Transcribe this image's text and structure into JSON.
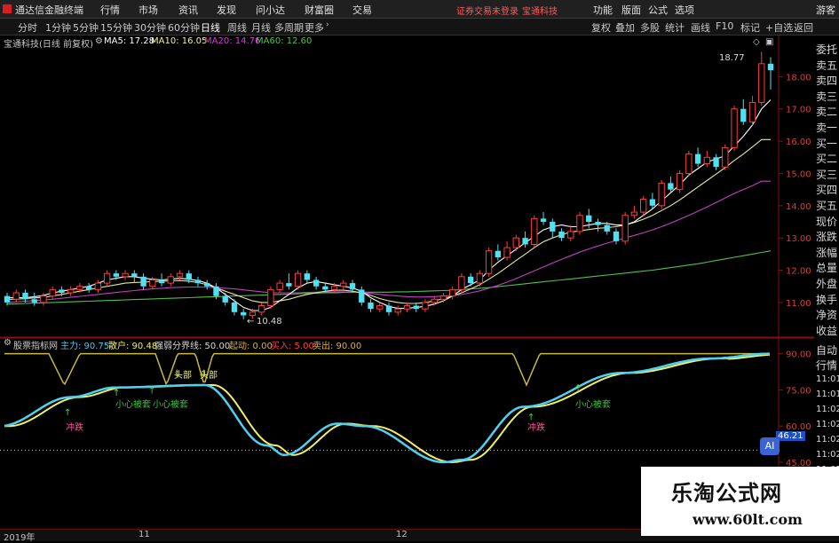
{
  "menubar": {
    "app_title": "通达信金融终端",
    "menus": [
      "行情",
      "市场",
      "资讯",
      "发现",
      "问小达",
      "财富圈",
      "交易"
    ],
    "notice": "证券交易未登录",
    "security": "宝通科技",
    "right_menus": [
      "功能",
      "版面",
      "公式",
      "选项"
    ],
    "guest": "游客"
  },
  "toolbar": {
    "tabs": [
      "分时",
      "1分钟",
      "5分钟",
      "15分钟",
      "30分钟",
      "60分钟",
      "日线",
      "周线",
      "月线",
      "多周期",
      "更多"
    ],
    "active_tab": "日线",
    "right_buttons": [
      "复权",
      "叠加",
      "多股",
      "统计",
      "画线",
      "F10",
      "标记",
      "+自选",
      "返回"
    ]
  },
  "info": {
    "title": "宝通科技(日线 前复权)",
    "ma5": "MA5: 17.28",
    "ma10": "MA10: 16.05",
    "ma20": "MA20: 14.76",
    "ma60": "MA60: 12.60",
    "colors": {
      "ma5": "#ffffff",
      "ma10": "#f0f0a0",
      "ma20": "#d040d0",
      "ma60": "#50c050"
    }
  },
  "price_axis": {
    "labels": [
      "18.00",
      "17.00",
      "16.00",
      "15.00",
      "14.00",
      "13.00",
      "12.00",
      "11.00"
    ]
  },
  "annotations": {
    "high": "18.77",
    "low": "10.48"
  },
  "quote_panel": {
    "items": [
      "委托",
      "卖五",
      "卖四",
      "卖三",
      "卖二",
      "卖一",
      "买一",
      "买二",
      "买三",
      "买四",
      "买五",
      "现价",
      "涨跌",
      "涨幅",
      "总量",
      "外盘",
      "换手",
      "净资",
      "收益"
    ],
    "bottom_items": [
      "自动",
      "行情"
    ],
    "times": [
      "11:01",
      "11:01",
      "11:02",
      "11:02",
      "11:02",
      "11:02",
      "11:02"
    ]
  },
  "indicator": {
    "name": "股票指标网",
    "main": "主力: 90.75",
    "retail": "散户: 90.48",
    "boundary": "强弱分界线: 50.00",
    "start": "起动: 0.00",
    "buy": "买入: 5.00",
    "sell": "卖出: 90.00",
    "axis_labels": [
      "90.00",
      "75.00",
      "60.00",
      "45.00"
    ],
    "current_value": "46.21",
    "labels": {
      "top": "头部",
      "careful": "小心被套",
      "bottom": "冲跌"
    }
  },
  "bottom_bar": {
    "labels": [
      "2019年",
      "11",
      "12"
    ]
  },
  "watermark": {
    "title": "乐淘公式网",
    "url": "www.60lt.com"
  },
  "ai_button": "AI",
  "chart_data": {
    "type": "candlestick",
    "title": "宝通科技(日线 前复权)",
    "ylim": [
      10.2,
      19.0
    ],
    "candles": [
      [
        11.2,
        11.0,
        11.3,
        10.9
      ],
      [
        11.1,
        11.3,
        11.4,
        11.0
      ],
      [
        11.3,
        11.1,
        11.4,
        11.0
      ],
      [
        11.1,
        11.0,
        11.3,
        10.9
      ],
      [
        11.0,
        11.2,
        11.3,
        10.9
      ],
      [
        11.2,
        11.4,
        11.5,
        11.1
      ],
      [
        11.4,
        11.3,
        11.5,
        11.2
      ],
      [
        11.3,
        11.4,
        11.5,
        11.2
      ],
      [
        11.4,
        11.5,
        11.6,
        11.3
      ],
      [
        11.5,
        11.4,
        11.6,
        11.3
      ],
      [
        11.4,
        11.6,
        11.7,
        11.3
      ],
      [
        11.6,
        11.9,
        12.0,
        11.5
      ],
      [
        11.9,
        11.8,
        12.0,
        11.7
      ],
      [
        11.8,
        11.9,
        12.0,
        11.7
      ],
      [
        11.9,
        11.8,
        12.0,
        11.6
      ],
      [
        11.8,
        11.5,
        11.9,
        11.4
      ],
      [
        11.5,
        11.7,
        11.8,
        11.4
      ],
      [
        11.7,
        11.6,
        11.9,
        11.5
      ],
      [
        11.6,
        11.8,
        11.9,
        11.5
      ],
      [
        11.8,
        11.9,
        12.0,
        11.7
      ],
      [
        11.9,
        11.7,
        12.0,
        11.6
      ],
      [
        11.7,
        11.6,
        11.8,
        11.5
      ],
      [
        11.6,
        11.5,
        11.7,
        11.4
      ],
      [
        11.5,
        11.2,
        11.6,
        11.1
      ],
      [
        11.2,
        11.0,
        11.3,
        10.9
      ],
      [
        11.0,
        10.7,
        11.1,
        10.6
      ],
      [
        10.7,
        10.6,
        10.8,
        10.48
      ],
      [
        10.6,
        10.7,
        10.8,
        10.5
      ],
      [
        10.7,
        10.9,
        11.0,
        10.6
      ],
      [
        10.9,
        11.4,
        11.5,
        10.8
      ],
      [
        11.4,
        11.6,
        11.7,
        11.3
      ],
      [
        11.6,
        11.5,
        11.9,
        11.4
      ],
      [
        11.5,
        11.9,
        12.0,
        11.4
      ],
      [
        11.9,
        11.7,
        12.0,
        11.6
      ],
      [
        11.7,
        11.5,
        11.8,
        11.4
      ],
      [
        11.5,
        11.4,
        11.6,
        11.3
      ],
      [
        11.4,
        11.5,
        11.6,
        11.3
      ],
      [
        11.5,
        11.6,
        11.7,
        11.4
      ],
      [
        11.6,
        11.4,
        11.7,
        11.3
      ],
      [
        11.4,
        11.0,
        11.5,
        10.9
      ],
      [
        11.0,
        10.8,
        11.1,
        10.7
      ],
      [
        10.8,
        10.9,
        11.0,
        10.7
      ],
      [
        10.9,
        10.7,
        11.0,
        10.6
      ],
      [
        10.7,
        10.8,
        10.9,
        10.6
      ],
      [
        10.8,
        10.9,
        11.0,
        10.7
      ],
      [
        10.9,
        10.8,
        11.0,
        10.7
      ],
      [
        10.8,
        11.0,
        11.1,
        10.7
      ],
      [
        11.0,
        11.1,
        11.2,
        10.9
      ],
      [
        11.1,
        11.2,
        11.3,
        11.0
      ],
      [
        11.2,
        11.4,
        11.5,
        11.1
      ],
      [
        11.4,
        11.8,
        11.9,
        11.3
      ],
      [
        11.8,
        11.6,
        11.9,
        11.5
      ],
      [
        11.6,
        11.9,
        12.0,
        11.5
      ],
      [
        11.9,
        12.6,
        12.7,
        11.8
      ],
      [
        12.6,
        12.4,
        12.8,
        12.3
      ],
      [
        12.4,
        12.7,
        12.9,
        12.3
      ],
      [
        12.7,
        13.0,
        13.1,
        12.6
      ],
      [
        13.0,
        12.8,
        13.2,
        12.7
      ],
      [
        12.8,
        13.6,
        13.7,
        12.7
      ],
      [
        13.6,
        13.5,
        13.8,
        13.4
      ],
      [
        13.5,
        13.2,
        13.6,
        13.0
      ],
      [
        13.2,
        13.0,
        13.3,
        12.9
      ],
      [
        13.0,
        13.2,
        13.4,
        12.9
      ],
      [
        13.2,
        13.7,
        13.8,
        13.1
      ],
      [
        13.7,
        13.5,
        13.9,
        13.3
      ],
      [
        13.5,
        13.4,
        13.6,
        13.2
      ],
      [
        13.4,
        13.2,
        13.5,
        13.1
      ],
      [
        13.2,
        12.9,
        13.3,
        12.8
      ],
      [
        12.9,
        13.7,
        13.8,
        12.8
      ],
      [
        13.7,
        13.8,
        14.0,
        13.6
      ],
      [
        13.8,
        14.2,
        14.3,
        13.7
      ],
      [
        14.2,
        14.0,
        14.4,
        13.9
      ],
      [
        14.0,
        14.7,
        14.8,
        13.9
      ],
      [
        14.7,
        14.5,
        14.9,
        14.4
      ],
      [
        14.5,
        15.0,
        15.1,
        14.4
      ],
      [
        15.0,
        15.6,
        15.7,
        14.9
      ],
      [
        15.6,
        15.3,
        15.8,
        15.2
      ],
      [
        15.3,
        15.5,
        15.7,
        15.2
      ],
      [
        15.5,
        15.2,
        15.6,
        15.1
      ],
      [
        15.2,
        15.8,
        15.9,
        15.1
      ],
      [
        15.8,
        17.0,
        17.1,
        15.7
      ],
      [
        17.0,
        16.6,
        17.3,
        16.5
      ],
      [
        16.6,
        17.2,
        17.4,
        16.5
      ],
      [
        17.2,
        18.4,
        18.77,
        17.1
      ],
      [
        18.4,
        18.2,
        18.6,
        17.6
      ]
    ],
    "ma5": [
      11.15,
      11.15,
      11.15,
      11.18,
      11.22,
      11.3,
      11.35,
      11.4,
      11.45,
      11.5,
      11.6,
      11.7,
      11.75,
      11.8,
      11.8,
      11.75,
      11.72,
      11.7,
      11.72,
      11.75,
      11.72,
      11.68,
      11.6,
      11.45,
      11.25,
      11.05,
      10.85,
      10.75,
      10.75,
      10.85,
      11.05,
      11.25,
      11.45,
      11.6,
      11.65,
      11.6,
      11.55,
      11.5,
      11.45,
      11.35,
      11.15,
      11.0,
      10.88,
      10.82,
      10.82,
      10.85,
      10.88,
      10.95,
      11.05,
      11.2,
      11.4,
      11.55,
      11.7,
      12.0,
      12.25,
      12.45,
      12.65,
      12.85,
      13.05,
      13.25,
      13.35,
      13.4,
      13.35,
      13.35,
      13.4,
      13.45,
      13.45,
      13.4,
      13.4,
      13.5,
      13.7,
      13.9,
      14.15,
      14.4,
      14.65,
      14.95,
      15.15,
      15.35,
      15.45,
      15.55,
      15.85,
      16.15,
      16.5,
      17.0,
      17.28
    ],
    "ma10": [
      11.1,
      11.1,
      11.12,
      11.14,
      11.16,
      11.2,
      11.25,
      11.3,
      11.35,
      11.4,
      11.45,
      11.5,
      11.55,
      11.6,
      11.62,
      11.63,
      11.65,
      11.66,
      11.67,
      11.68,
      11.66,
      11.62,
      11.55,
      11.45,
      11.35,
      11.25,
      11.15,
      11.05,
      11.0,
      11.0,
      11.05,
      11.1,
      11.18,
      11.25,
      11.3,
      11.35,
      11.38,
      11.38,
      11.35,
      11.3,
      11.22,
      11.12,
      11.05,
      11.0,
      10.97,
      10.97,
      11.0,
      11.05,
      11.12,
      11.2,
      11.3,
      11.42,
      11.55,
      11.72,
      11.9,
      12.1,
      12.3,
      12.5,
      12.7,
      12.88,
      13.0,
      13.1,
      13.18,
      13.22,
      13.26,
      13.3,
      13.32,
      13.35,
      13.4,
      13.48,
      13.58,
      13.7,
      13.85,
      14.0,
      14.18,
      14.38,
      14.58,
      14.78,
      14.98,
      15.18,
      15.4,
      15.6,
      15.82,
      16.05,
      16.05
    ],
    "ma20": [
      11.0,
      11.02,
      11.04,
      11.06,
      11.08,
      11.1,
      11.13,
      11.16,
      11.19,
      11.22,
      11.25,
      11.28,
      11.31,
      11.34,
      11.37,
      11.4,
      11.42,
      11.44,
      11.46,
      11.47,
      11.48,
      11.48,
      11.47,
      11.46,
      11.44,
      11.42,
      11.39,
      11.36,
      11.33,
      11.3,
      11.3,
      11.3,
      11.3,
      11.31,
      11.32,
      11.33,
      11.33,
      11.33,
      11.32,
      11.3,
      11.28,
      11.25,
      11.22,
      11.2,
      11.18,
      11.17,
      11.17,
      11.18,
      11.2,
      11.22,
      11.25,
      11.3,
      11.36,
      11.44,
      11.53,
      11.63,
      11.74,
      11.86,
      11.98,
      12.1,
      12.22,
      12.34,
      12.45,
      12.56,
      12.66,
      12.75,
      12.84,
      12.92,
      13.0,
      13.08,
      13.16,
      13.25,
      13.35,
      13.46,
      13.58,
      13.7,
      13.83,
      13.96,
      14.1,
      14.24,
      14.38,
      14.5,
      14.62,
      14.76,
      14.76
    ],
    "ma60": [
      10.95,
      10.96,
      10.97,
      10.98,
      10.99,
      11.0,
      11.01,
      11.02,
      11.03,
      11.04,
      11.05,
      11.06,
      11.07,
      11.08,
      11.09,
      11.1,
      11.11,
      11.12,
      11.13,
      11.14,
      11.15,
      11.16,
      11.17,
      11.18,
      11.19,
      11.2,
      11.21,
      11.22,
      11.23,
      11.24,
      11.25,
      11.26,
      11.27,
      11.28,
      11.29,
      11.3,
      11.3,
      11.31,
      11.31,
      11.32,
      11.32,
      11.32,
      11.32,
      11.33,
      11.33,
      11.34,
      11.35,
      11.36,
      11.37,
      11.38,
      11.4,
      11.42,
      11.44,
      11.46,
      11.49,
      11.52,
      11.55,
      11.58,
      11.61,
      11.64,
      11.67,
      11.7,
      11.73,
      11.76,
      11.79,
      11.82,
      11.85,
      11.88,
      11.91,
      11.94,
      11.97,
      12.0,
      12.04,
      12.08,
      12.12,
      12.16,
      12.2,
      12.25,
      12.3,
      12.35,
      12.4,
      12.45,
      12.5,
      12.55,
      12.6
    ]
  }
}
